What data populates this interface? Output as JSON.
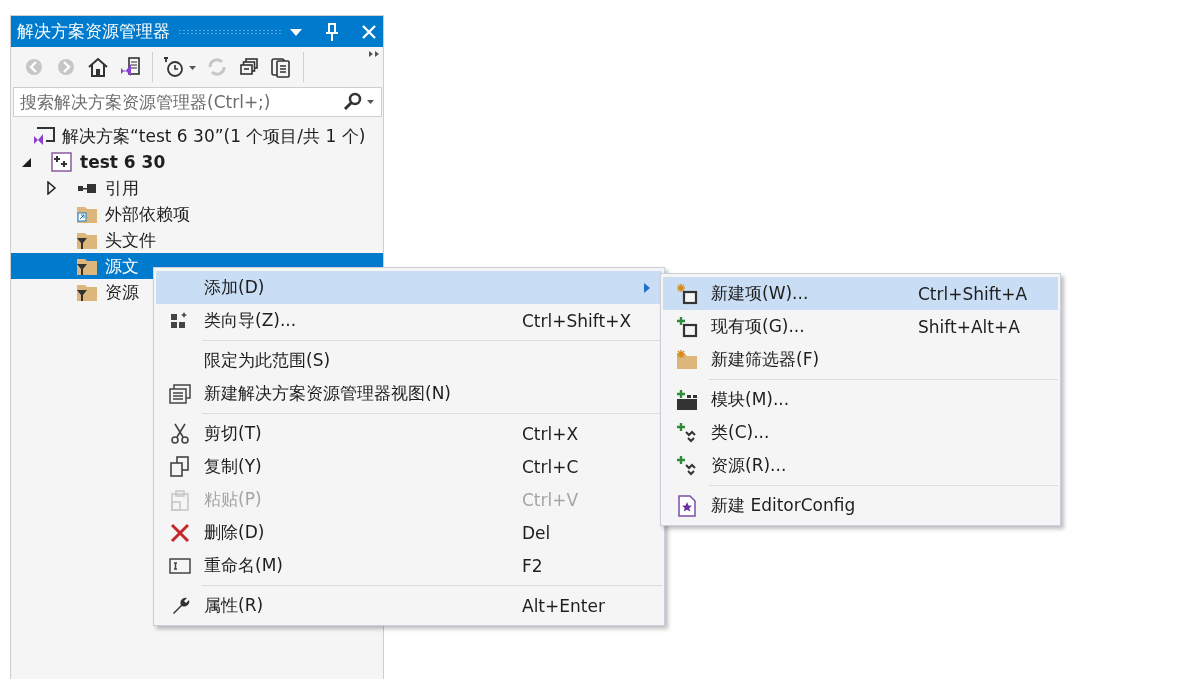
{
  "panel": {
    "title": "解决方案资源管理器",
    "toolbar": [
      {
        "kind": "button",
        "disabled": true
      },
      {
        "kind": "button",
        "disabled": true
      },
      {
        "kind": "button",
        "disabled": false
      },
      {
        "kind": "button",
        "disabled": false
      },
      {
        "kind": "separator"
      },
      {
        "kind": "dropdown",
        "disabled": false
      },
      {
        "kind": "button",
        "disabled": true
      },
      {
        "kind": "button",
        "disabled": false
      },
      {
        "kind": "button",
        "disabled": false
      },
      {
        "kind": "separator"
      }
    ],
    "search": {
      "placeholder": "搜索解决方案资源管理器(Ctrl+;)"
    },
    "tree": [
      {
        "label": "解决方案“test 6 30”(1 个项目/共 1 个)",
        "kind": "solution",
        "selected": false,
        "children": [
          {
            "label": "test 6 30",
            "kind": "project",
            "expanded": true,
            "selected": false,
            "children": [
              {
                "label": "引用",
                "kind": "references",
                "expanded": false,
                "selected": false
              },
              {
                "label": "外部依赖项",
                "kind": "external",
                "selected": false
              },
              {
                "label": "头文件",
                "kind": "filter",
                "selected": false
              },
              {
                "label": "源文",
                "kind": "filter",
                "selected": true
              },
              {
                "label": "资源",
                "kind": "filter",
                "selected": false
              }
            ]
          }
        ]
      }
    ]
  },
  "context_menu": [
    {
      "kind": "item",
      "label": "添加(D)",
      "has_submenu": true,
      "selected": true,
      "disabled": false
    },
    {
      "kind": "item",
      "label": "类向导(Z)...",
      "shortcut": "Ctrl+Shift+X",
      "selected": false,
      "disabled": false
    },
    {
      "kind": "separator"
    },
    {
      "kind": "item",
      "label": "限定为此范围(S)",
      "selected": false,
      "disabled": false
    },
    {
      "kind": "item",
      "label": "新建解决方案资源管理器视图(N)",
      "selected": false,
      "disabled": false
    },
    {
      "kind": "separator"
    },
    {
      "kind": "item",
      "label": "剪切(T)",
      "shortcut": "Ctrl+X",
      "selected": false,
      "disabled": false
    },
    {
      "kind": "item",
      "label": "复制(Y)",
      "shortcut": "Ctrl+C",
      "selected": false,
      "disabled": false
    },
    {
      "kind": "item",
      "label": "粘贴(P)",
      "shortcut": "Ctrl+V",
      "selected": false,
      "disabled": true
    },
    {
      "kind": "item",
      "label": "删除(D)",
      "shortcut": "Del",
      "selected": false,
      "disabled": false
    },
    {
      "kind": "item",
      "label": "重命名(M)",
      "shortcut": "F2",
      "selected": false,
      "disabled": false
    },
    {
      "kind": "separator"
    },
    {
      "kind": "item",
      "label": "属性(R)",
      "shortcut": "Alt+Enter",
      "selected": false,
      "disabled": false
    }
  ],
  "submenu": [
    {
      "kind": "item",
      "label": "新建项(W)...",
      "shortcut": "Ctrl+Shift+A",
      "selected": true
    },
    {
      "kind": "item",
      "label": "现有项(G)...",
      "shortcut": "Shift+Alt+A",
      "selected": false
    },
    {
      "kind": "item",
      "label": "新建筛选器(F)",
      "selected": false
    },
    {
      "kind": "separator"
    },
    {
      "kind": "item",
      "label": "模块(M)...",
      "selected": false
    },
    {
      "kind": "item",
      "label": "类(C)...",
      "selected": false
    },
    {
      "kind": "item",
      "label": "资源(R)...",
      "selected": false
    },
    {
      "kind": "separator"
    },
    {
      "kind": "item",
      "label": "新建 EditorConfig",
      "selected": false
    }
  ]
}
